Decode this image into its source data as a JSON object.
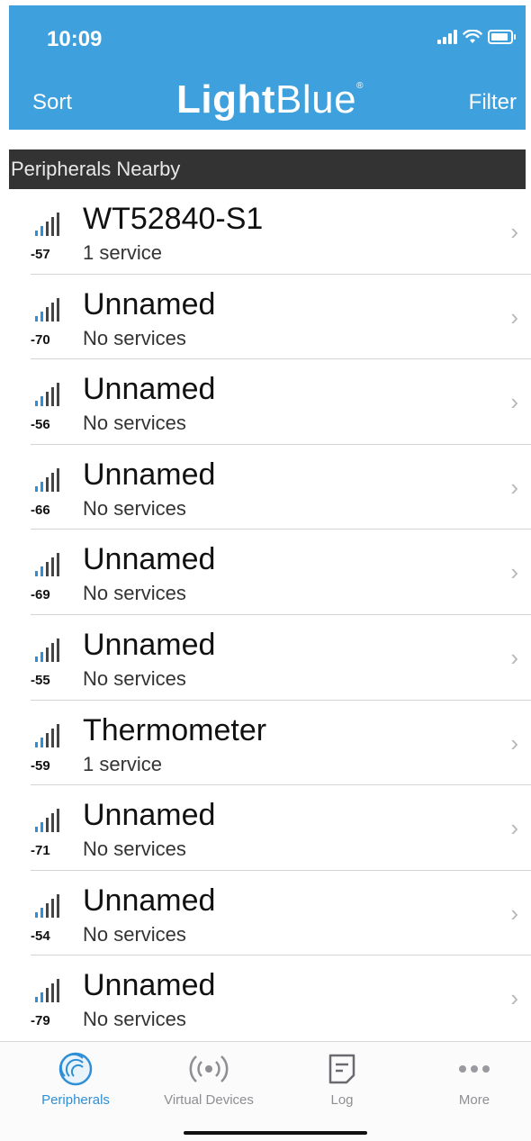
{
  "status_bar": {
    "time": "10:09"
  },
  "nav": {
    "left_label": "Sort",
    "right_label": "Filter",
    "brand_bold": "Light",
    "brand_light": "Blue"
  },
  "section": {
    "title": "Peripherals Nearby"
  },
  "peripherals": [
    {
      "rssi": "-57",
      "name": "WT52840-S1",
      "services": "1 service"
    },
    {
      "rssi": "-70",
      "name": "Unnamed",
      "services": "No services"
    },
    {
      "rssi": "-56",
      "name": "Unnamed",
      "services": "No services"
    },
    {
      "rssi": "-66",
      "name": "Unnamed",
      "services": "No services"
    },
    {
      "rssi": "-69",
      "name": "Unnamed",
      "services": "No services"
    },
    {
      "rssi": "-55",
      "name": "Unnamed",
      "services": "No services"
    },
    {
      "rssi": "-59",
      "name": "Thermometer",
      "services": "1 service"
    },
    {
      "rssi": "-71",
      "name": "Unnamed",
      "services": "No services"
    },
    {
      "rssi": "-54",
      "name": "Unnamed",
      "services": "No services"
    },
    {
      "rssi": "-79",
      "name": "Unnamed",
      "services": "No services"
    }
  ],
  "tabs": [
    {
      "label": "Peripherals",
      "icon": "radar-icon",
      "active": true
    },
    {
      "label": "Virtual Devices",
      "icon": "broadcast-icon",
      "active": false
    },
    {
      "label": "Log",
      "icon": "log-icon",
      "active": false
    },
    {
      "label": "More",
      "icon": "more-icon",
      "active": false
    }
  ],
  "colors": {
    "header_blue": "#3ea0dd",
    "section_dark": "#333333",
    "active_tab": "#2f8fd6",
    "signal_blue": "#2f8fd6"
  }
}
